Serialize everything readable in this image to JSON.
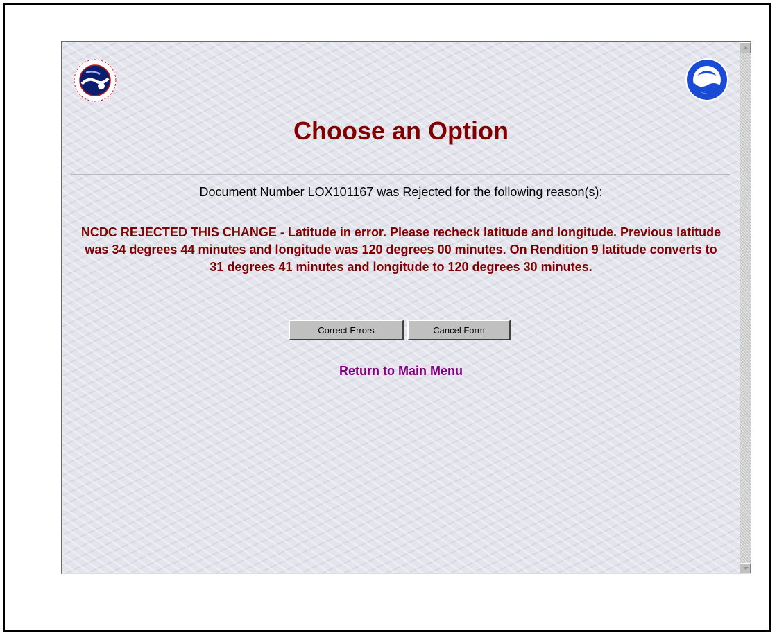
{
  "page": {
    "title": "Choose an Option",
    "document_line": "Document Number LOX101167 was Rejected for the following reason(s):",
    "reason_text": "NCDC REJECTED THIS CHANGE - Latitude in error. Please recheck latitude and longitude. Previous latitude was 34 degrees 44 minutes and longitude was 120 degrees 00 minutes. On Rendition 9 latitude converts to 31 degrees 41 minutes and longitude to 120 degrees 30 minutes."
  },
  "buttons": {
    "correct_label": "Correct Errors",
    "cancel_label": "Cancel Form"
  },
  "links": {
    "return_label": "Return to Main Menu"
  },
  "logos": {
    "left": "nws-seal-icon",
    "right": "noaa-seal-icon"
  },
  "colors": {
    "title": "#800000",
    "reason": "#800000",
    "visited_link": "#800080",
    "background": "#e4e4ec"
  }
}
